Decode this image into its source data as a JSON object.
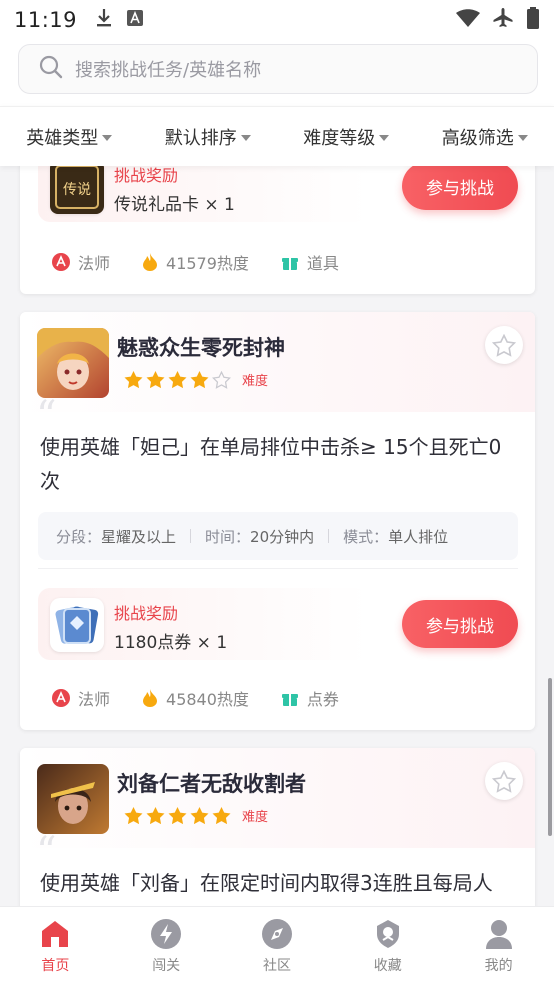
{
  "status": {
    "time": "11:19"
  },
  "search": {
    "placeholder": "搜索挑战任务/英雄名称"
  },
  "filters": [
    "英雄类型",
    "默认排序",
    "难度等级",
    "高级筛选"
  ],
  "cards": [
    {
      "reward_label": "挑战奖励",
      "reward_name": "传说礼品卡 × 1",
      "join_label": "参与挑战",
      "tags": {
        "role": "法师",
        "heat": "41579热度",
        "type": "道具"
      }
    },
    {
      "title": "魅惑众生零死封神",
      "stars": 4,
      "difficulty_label": "难度",
      "description": "使用英雄「妲己」在单局排位中击杀≥ 15个且死亡0次",
      "meta": {
        "rank_key": "分段：",
        "rank_val": "星耀及以上",
        "time_key": "时间：",
        "time_val": "20分钟内",
        "mode_key": "模式：",
        "mode_val": "单人排位"
      },
      "reward_label": "挑战奖励",
      "reward_name": "1180点券 × 1",
      "join_label": "参与挑战",
      "tags": {
        "role": "法师",
        "heat": "45840热度",
        "type": "点券"
      }
    },
    {
      "title": "刘备仁者无敌收割者",
      "stars": 5,
      "difficulty_label": "难度",
      "description": "使用英雄「刘备」在限定时间内取得3连胜且每局",
      "description_cut": "人头数"
    }
  ],
  "nav": [
    {
      "label": "首页",
      "icon": "home-icon",
      "active": true
    },
    {
      "label": "闯关",
      "icon": "lightning-icon",
      "active": false
    },
    {
      "label": "社区",
      "icon": "compass-icon",
      "active": false
    },
    {
      "label": "收藏",
      "icon": "badge-icon",
      "active": false
    },
    {
      "label": "我的",
      "icon": "user-icon",
      "active": false
    }
  ],
  "colors": {
    "accent": "#e8444b",
    "star": "#f7a90f",
    "gift": "#2ec4a6"
  }
}
